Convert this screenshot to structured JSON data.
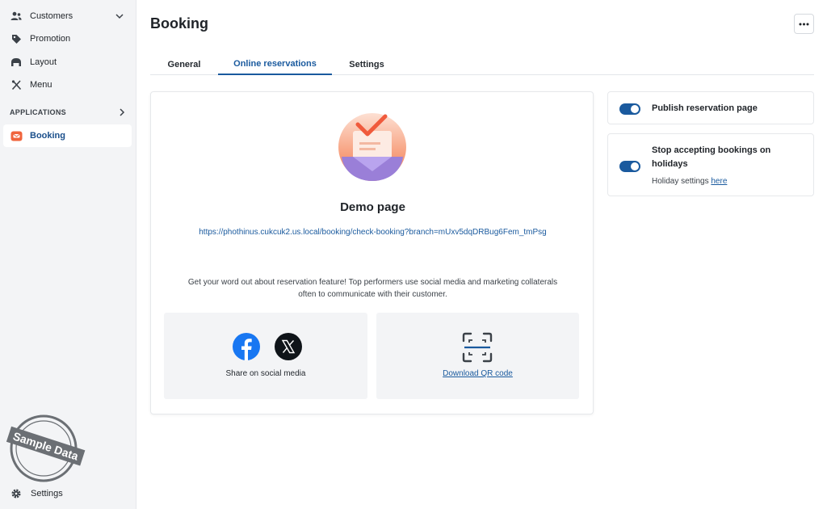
{
  "sidebar": {
    "items": [
      {
        "label": "Customers",
        "icon": "users-icon"
      },
      {
        "label": "Promotion",
        "icon": "tag-icon"
      },
      {
        "label": "Layout",
        "icon": "layout-icon"
      },
      {
        "label": "Menu",
        "icon": "utensils-icon"
      }
    ],
    "section_label": "APPLICATIONS",
    "active_item": {
      "label": "Booking",
      "icon": "booking-icon"
    },
    "settings_label": "Settings",
    "stamp_text": "Sample Data"
  },
  "header": {
    "title": "Booking"
  },
  "tabs": [
    {
      "label": "General"
    },
    {
      "label": "Online reservations"
    },
    {
      "label": "Settings"
    }
  ],
  "main": {
    "demo_title": "Demo page",
    "url": "https://phothinus.cukcuk2.us.local/booking/check-booking?branch=mUxv5dqDRBug6Fem_tmPsg",
    "promo_line1": "Get your word out about reservation feature! Top performers use social media and marketing collaterals",
    "promo_line2": "often to communicate with their customer.",
    "share_label": "Share on social media",
    "qr_label": "Download QR code"
  },
  "side": {
    "publish_label": "Publish reservation page",
    "holiday_label": "Stop accepting bookings on holidays",
    "holiday_sub": "Holiday settings",
    "holiday_link": "here"
  },
  "colors": {
    "accent": "#1a5a9e",
    "booking_brand": "#f0643c",
    "sidebar_bg": "#f3f4f6"
  }
}
